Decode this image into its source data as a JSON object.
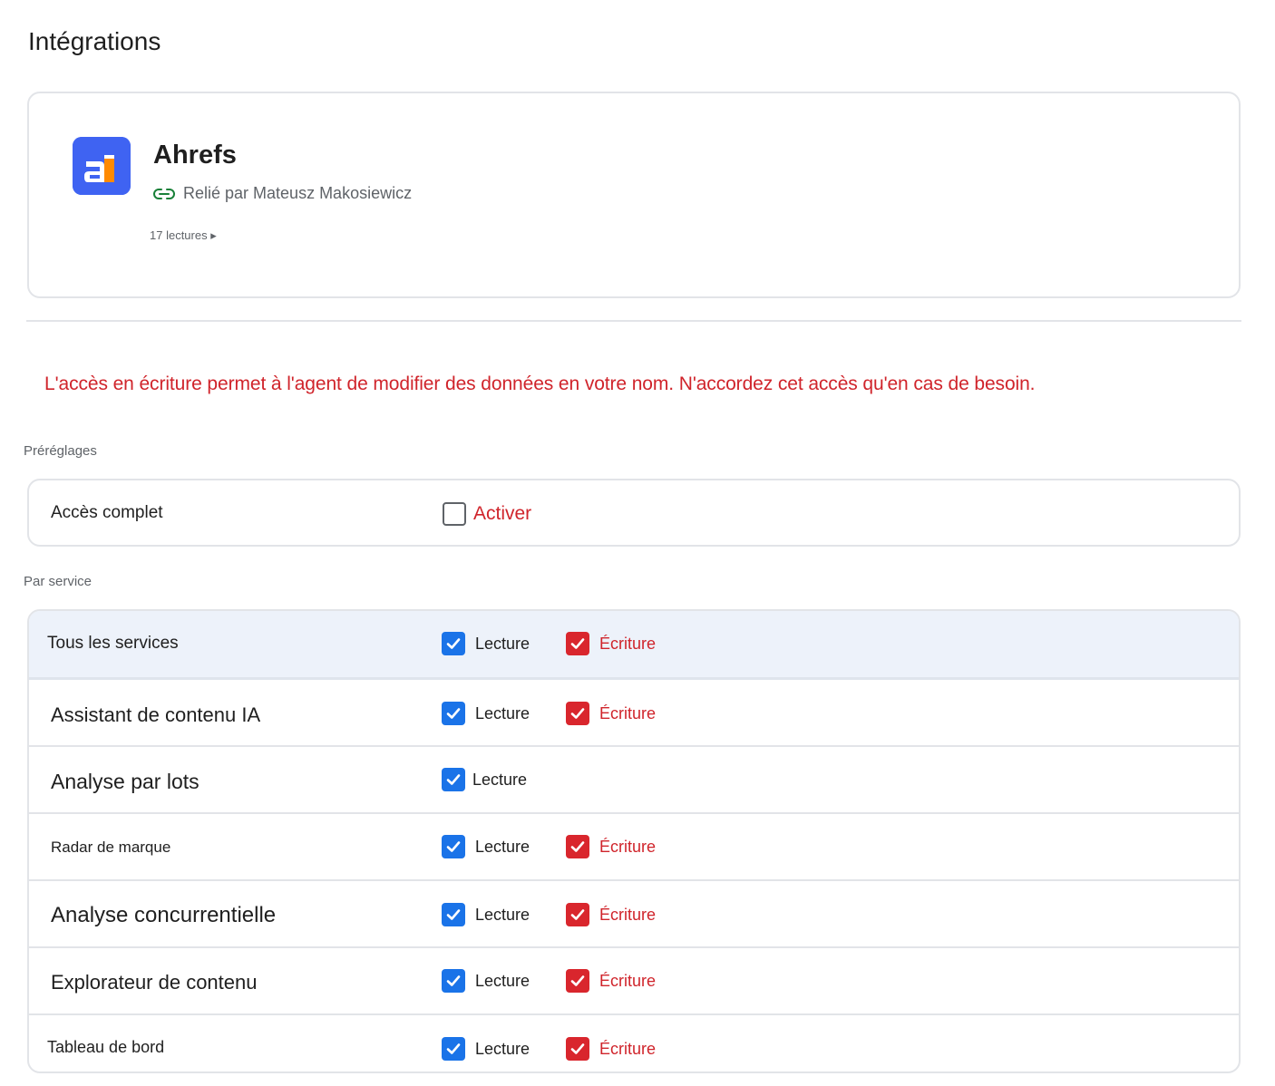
{
  "page": {
    "title": "Intégrations"
  },
  "integration": {
    "name": "Ahrefs",
    "logo_icon": "ahrefs-logo",
    "brand_color": "#3f63f2",
    "linked_icon": "link-icon",
    "linked_by": "Relié par Mateusz Makosiewicz",
    "reads": "17 lectures ▸"
  },
  "warning": "L'accès en écriture permet à l'agent de modifier des données en votre nom. N'accordez cet accès qu'en cas de besoin.",
  "presets": {
    "section_label": "Préréglages",
    "full_access": {
      "label": "Accès complet",
      "toggle_label": "Activer",
      "checked": false
    }
  },
  "services": {
    "section_label": "Par service",
    "read_label": "Lecture",
    "write_label": "Écriture",
    "rows": [
      {
        "name": "Tous les services",
        "read": true,
        "write": true
      },
      {
        "name": "Assistant de contenu IA",
        "read": true,
        "write": true
      },
      {
        "name": "Analyse par lots",
        "read": true,
        "write": null
      },
      {
        "name": "Radar de marque",
        "read": true,
        "write": true
      },
      {
        "name": "Analyse concurrentielle",
        "read": true,
        "write": true
      },
      {
        "name": "Explorateur de contenu",
        "read": true,
        "write": true
      },
      {
        "name": "Tableau de bord",
        "read": true,
        "write": true
      }
    ]
  },
  "colors": {
    "accent_blue": "#1a73e8",
    "danger_red": "#d0242b",
    "header_row_bg": "#edf2fa"
  }
}
